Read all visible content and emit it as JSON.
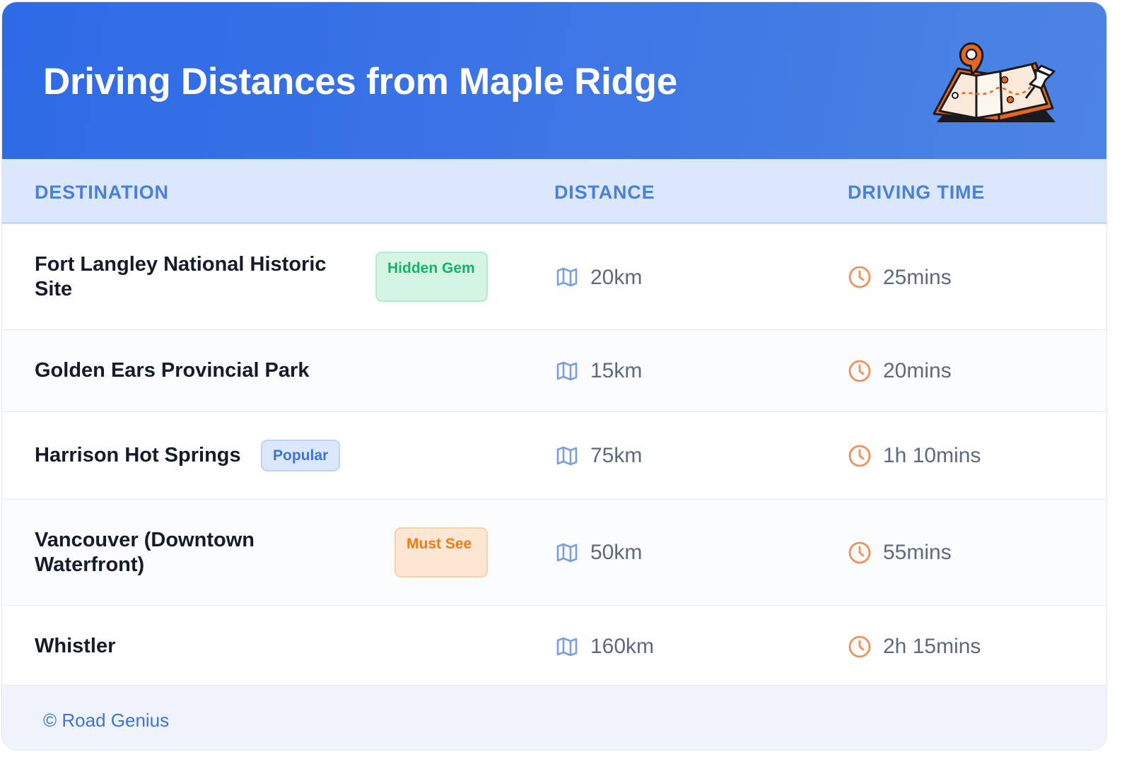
{
  "header": {
    "title": "Driving Distances from Maple Ridge",
    "illustration": "map-with-location-pin-and-pushpin-illustration"
  },
  "table": {
    "columns": {
      "destination": "DESTINATION",
      "distance": "DISTANCE",
      "driving_time": "DRIVING TIME"
    },
    "distance_icon": "map-icon",
    "time_icon": "clock-icon",
    "rows": [
      {
        "destination": "Fort Langley National Historic Site",
        "badge": "Hidden Gem",
        "distance": "20km",
        "time": "25mins"
      },
      {
        "destination": "Golden Ears Provincial Park",
        "badge": "",
        "distance": "15km",
        "time": "20mins"
      },
      {
        "destination": "Harrison Hot Springs",
        "badge": "Popular",
        "distance": "75km",
        "time": "1h 10mins"
      },
      {
        "destination": "Vancouver (Downtown Waterfront)",
        "badge": "Must See",
        "distance": "50km",
        "time": "55mins"
      },
      {
        "destination": "Whistler",
        "badge": "",
        "distance": "160km",
        "time": "2h 15mins"
      }
    ]
  },
  "colors": {
    "header_gradient_start": "#2f6ae6",
    "header_gradient_end": "#4d84e3",
    "column_header_text": "#4a7fdc",
    "badge_hidden_gem": "#15b36a",
    "badge_popular": "#3f74d6",
    "badge_must_see": "#f07a18",
    "map_icon": "#7a9ee0",
    "clock_icon": "#f0915a"
  },
  "footer": {
    "credit": "© Road Genius"
  }
}
